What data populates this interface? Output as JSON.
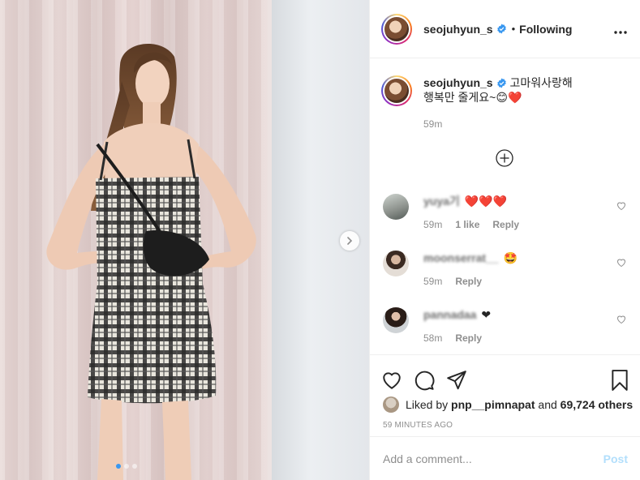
{
  "post": {
    "username": "seojuhyun_s",
    "follow_state": "Following",
    "separator": "•",
    "more_icon": "more-horizontal-icon",
    "media_slides": 3,
    "active_slide": 1
  },
  "caption": {
    "username": "seojuhyun_s",
    "text": "고마워사랑해 행복만 줄게요~😊❤️",
    "time": "59m"
  },
  "comments": [
    {
      "username": "yuya기",
      "text": "❤️❤️❤️",
      "time": "59m",
      "likes": "1 like",
      "reply": "Reply"
    },
    {
      "username": "moonserrat__",
      "text": "🤩",
      "time": "59m",
      "reply": "Reply"
    },
    {
      "username": "pannadaa",
      "text": "❤",
      "time": "58m",
      "reply": "Reply"
    }
  ],
  "likes": {
    "prefix": "Liked by",
    "user": "pnp__pimnapat",
    "and": "and",
    "others": "69,724 others"
  },
  "posted_ago": "59 MINUTES AGO",
  "composer": {
    "placeholder": "Add a comment...",
    "post_label": "Post"
  },
  "colors": {
    "verified_blue": "#3897f0",
    "post_disabled": "#b2dffc",
    "muted_text": "#8e8e8e",
    "heart_red": "#ed4956"
  }
}
